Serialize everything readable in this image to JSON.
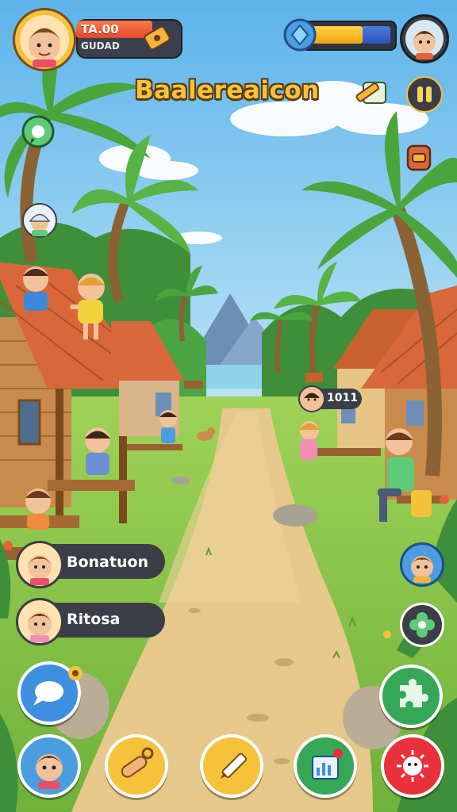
{
  "game": {
    "title": "Baalereaicon"
  },
  "hud": {
    "player_value": "TA.00",
    "player_sub": "GUDAD",
    "energy_level_percent": 64
  },
  "npc_tag": {
    "value": "1011"
  },
  "chat_entries": [
    {
      "name": "Bonatuon"
    },
    {
      "name": "Ritosa"
    }
  ],
  "icons": {
    "map_pin": "map-pin-icon",
    "crystal": "crystal-icon",
    "edit_note": "pencil-note-icon",
    "pause": "pause-icon",
    "backpack": "backpack-icon",
    "flower": "flower-icon",
    "puzzle": "puzzle-icon",
    "chat": "chat-bubble-icon",
    "hand": "hand-icon",
    "pencil": "pencil-icon",
    "stats": "chart-icon",
    "virus": "virus-icon"
  },
  "colors": {
    "sky": "#7cc6ee",
    "grass": "#8cc84a",
    "path": "#e6c98a",
    "title": "#f6c23a",
    "energy": "#f1a510"
  }
}
